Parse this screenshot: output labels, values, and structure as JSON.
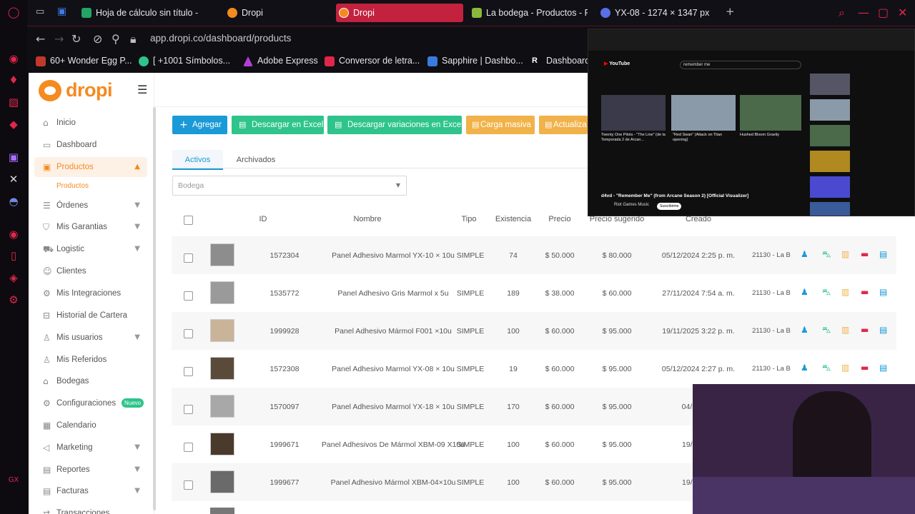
{
  "browser": {
    "tabs": [
      {
        "label": "Hoja de cálculo sin título - ",
        "color": "#23a566",
        "active": false
      },
      {
        "label": "Dropi",
        "color": "#f58a1f",
        "active": false
      },
      {
        "label": "Dropi",
        "color": "#f58a1f",
        "active": true
      },
      {
        "label": "La bodega - Productos - Pe",
        "color": "#8ab83a",
        "active": false
      },
      {
        "label": "YX-08 - 1274 × 1347 px",
        "color": "#5a6ee8",
        "active": false
      }
    ],
    "new_tab": "+",
    "url": "app.dropi.co/dashboard/products",
    "bookmarks": [
      {
        "label": "60+ Wonder Egg P...",
        "color": "#c0392b"
      },
      {
        "label": "[ +1001 Símbolos...",
        "color": "#2ec48b"
      },
      {
        "label": "Adobe Express",
        "color": "#b13fd6"
      },
      {
        "label": "Conversor de letra...",
        "color": "#e0274b"
      },
      {
        "label": "Sapphire | Dashbo...",
        "color": "#3a7be0"
      },
      {
        "label": "Dashboard",
        "color": "#ffffff"
      }
    ]
  },
  "logo": {
    "text": "dropi"
  },
  "sidebar": {
    "items": [
      {
        "label": "Inicio",
        "icon": "home-icon",
        "glyph": "⌂",
        "chevron": false
      },
      {
        "label": "Dashboard",
        "icon": "dashboard-icon",
        "glyph": "▭",
        "chevron": false
      },
      {
        "label": "Productos",
        "icon": "box-icon",
        "glyph": "▣",
        "chevron": true,
        "active": true
      },
      {
        "label": "Órdenes",
        "icon": "orders-icon",
        "glyph": "☰",
        "chevron": true
      },
      {
        "label": "Mis Garantias",
        "icon": "warranty-icon",
        "glyph": "⛉",
        "chevron": true
      },
      {
        "label": "Logistic",
        "icon": "truck-icon",
        "glyph": "⛟",
        "chevron": true
      },
      {
        "label": "Clientes",
        "icon": "clients-icon",
        "glyph": "☺",
        "chevron": false
      },
      {
        "label": "Mis Integraciones",
        "icon": "integrations-icon",
        "glyph": "⚙",
        "chevron": false
      },
      {
        "label": "Historial de Cartera",
        "icon": "wallet-icon",
        "glyph": "⊟",
        "chevron": false
      },
      {
        "label": "Mis usuarios",
        "icon": "users-icon",
        "glyph": "♙",
        "chevron": true
      },
      {
        "label": "Mis Referidos",
        "icon": "referrals-icon",
        "glyph": "♙",
        "chevron": false
      },
      {
        "label": "Bodegas",
        "icon": "warehouse-icon",
        "glyph": "⌂",
        "chevron": false
      },
      {
        "label": "Configuraciones",
        "icon": "settings-icon",
        "glyph": "⚙",
        "chevron": false,
        "badge": "Nuevo"
      },
      {
        "label": "Calendario",
        "icon": "calendar-icon",
        "glyph": "▦",
        "chevron": false
      },
      {
        "label": "Marketing",
        "icon": "megaphone-icon",
        "glyph": "◁",
        "chevron": true
      },
      {
        "label": "Reportes",
        "icon": "reports-icon",
        "glyph": "▤",
        "chevron": true
      },
      {
        "label": "Facturas",
        "icon": "invoice-icon",
        "glyph": "▤",
        "chevron": true
      },
      {
        "label": "Transacciones",
        "icon": "transactions-icon",
        "glyph": "⇄",
        "chevron": false
      }
    ],
    "sub_item": "Productos"
  },
  "actions": {
    "add": "Agregar",
    "excel": "Descargar en Excel",
    "excel_variations": "Descargar variaciones en Excel",
    "bulk": "Carga masiva",
    "update": "Actualiza"
  },
  "tabs": {
    "active": "Activos",
    "archived": "Archivados"
  },
  "filter": {
    "placeholder": "Bodega"
  },
  "table": {
    "headers": {
      "id": "ID",
      "name": "Nombre",
      "type": "Tipo",
      "stock": "Existencia",
      "price": "Precio",
      "suggested": "Precio sugerido",
      "created": "Creado"
    },
    "rows": [
      {
        "id": "1572304",
        "name": "Panel Adhesivo Marmol YX-10 × 10u",
        "type": "SIMPLE",
        "stock": "74",
        "price": "$ 50.000",
        "suggested": "$ 80.000",
        "created": "05/12/2024 2:25 p. m.",
        "store": "21130 - La B",
        "thumb": "#8d8d8d"
      },
      {
        "id": "1535772",
        "name": "Panel Adhesivo Gris Marmol x 5u",
        "type": "SIMPLE",
        "stock": "189",
        "price": "$ 38.000",
        "suggested": "$ 60.000",
        "created": "27/11/2024 7:54 a. m.",
        "store": "21130 - La B",
        "thumb": "#9a9a9a"
      },
      {
        "id": "1999928",
        "name": "Panel Adhesivo Mármol F001 ×10u",
        "type": "SIMPLE",
        "stock": "100",
        "price": "$ 60.000",
        "suggested": "$ 95.000",
        "created": "19/11/2025 3:22 p. m.",
        "store": "21130 - La B",
        "thumb": "#c9b49a"
      },
      {
        "id": "1572308",
        "name": "Panel Adhesivo Marmol YX-08 × 10u",
        "type": "SIMPLE",
        "stock": "19",
        "price": "$ 60.000",
        "suggested": "$ 95.000",
        "created": "05/12/2024 2:27 p. m.",
        "store": "21130 - La B",
        "thumb": "#5a4a3a"
      },
      {
        "id": "1570097",
        "name": "Panel Adhesivo Marmol YX-18 × 10u",
        "type": "SIMPLE",
        "stock": "170",
        "price": "$ 60.000",
        "suggested": "$ 95.000",
        "created": "04/12/202",
        "store": "",
        "thumb": "#a8a8a8"
      },
      {
        "id": "1999671",
        "name": "Panel Adhesivos De Mármol XBM-09 X10u",
        "type": "SIMPLE",
        "stock": "100",
        "price": "$ 60.000",
        "suggested": "$ 95.000",
        "created": "19/11/202",
        "store": "",
        "thumb": "#4a3a2c"
      },
      {
        "id": "1999677",
        "name": "Panel Adhesivo Mármol XBM-04×10u",
        "type": "SIMPLE",
        "stock": "100",
        "price": "$ 60.000",
        "suggested": "$ 95.000",
        "created": "19/11/202",
        "store": "",
        "thumb": "#6a6a6a"
      }
    ]
  },
  "youtube": {
    "logo": "YouTube",
    "search": "remember me",
    "videos": [
      {
        "title": "Twenty One Pilots - \"The Line\" (de la Temporada 2 de Arcan...",
        "color": "#3a3a4a"
      },
      {
        "title": "\"Red Swan\" (Attack on Titan opening)",
        "color": "#8a9aa8"
      },
      {
        "title": "Hushed Bloom Gravity",
        "color": "#4a6a4a"
      }
    ],
    "now_playing": "d4vd - \"Remember Me\" (from Arcane Season 2) [Official Visualizer]",
    "channel": "Riot Games Music",
    "subscribe": "Suscribirme"
  },
  "colors": {
    "brand": "#f58a1f",
    "primary": "#1a9ad6",
    "success": "#2ec48b",
    "warning": "#f1b24a",
    "danger": "#e0274b"
  }
}
